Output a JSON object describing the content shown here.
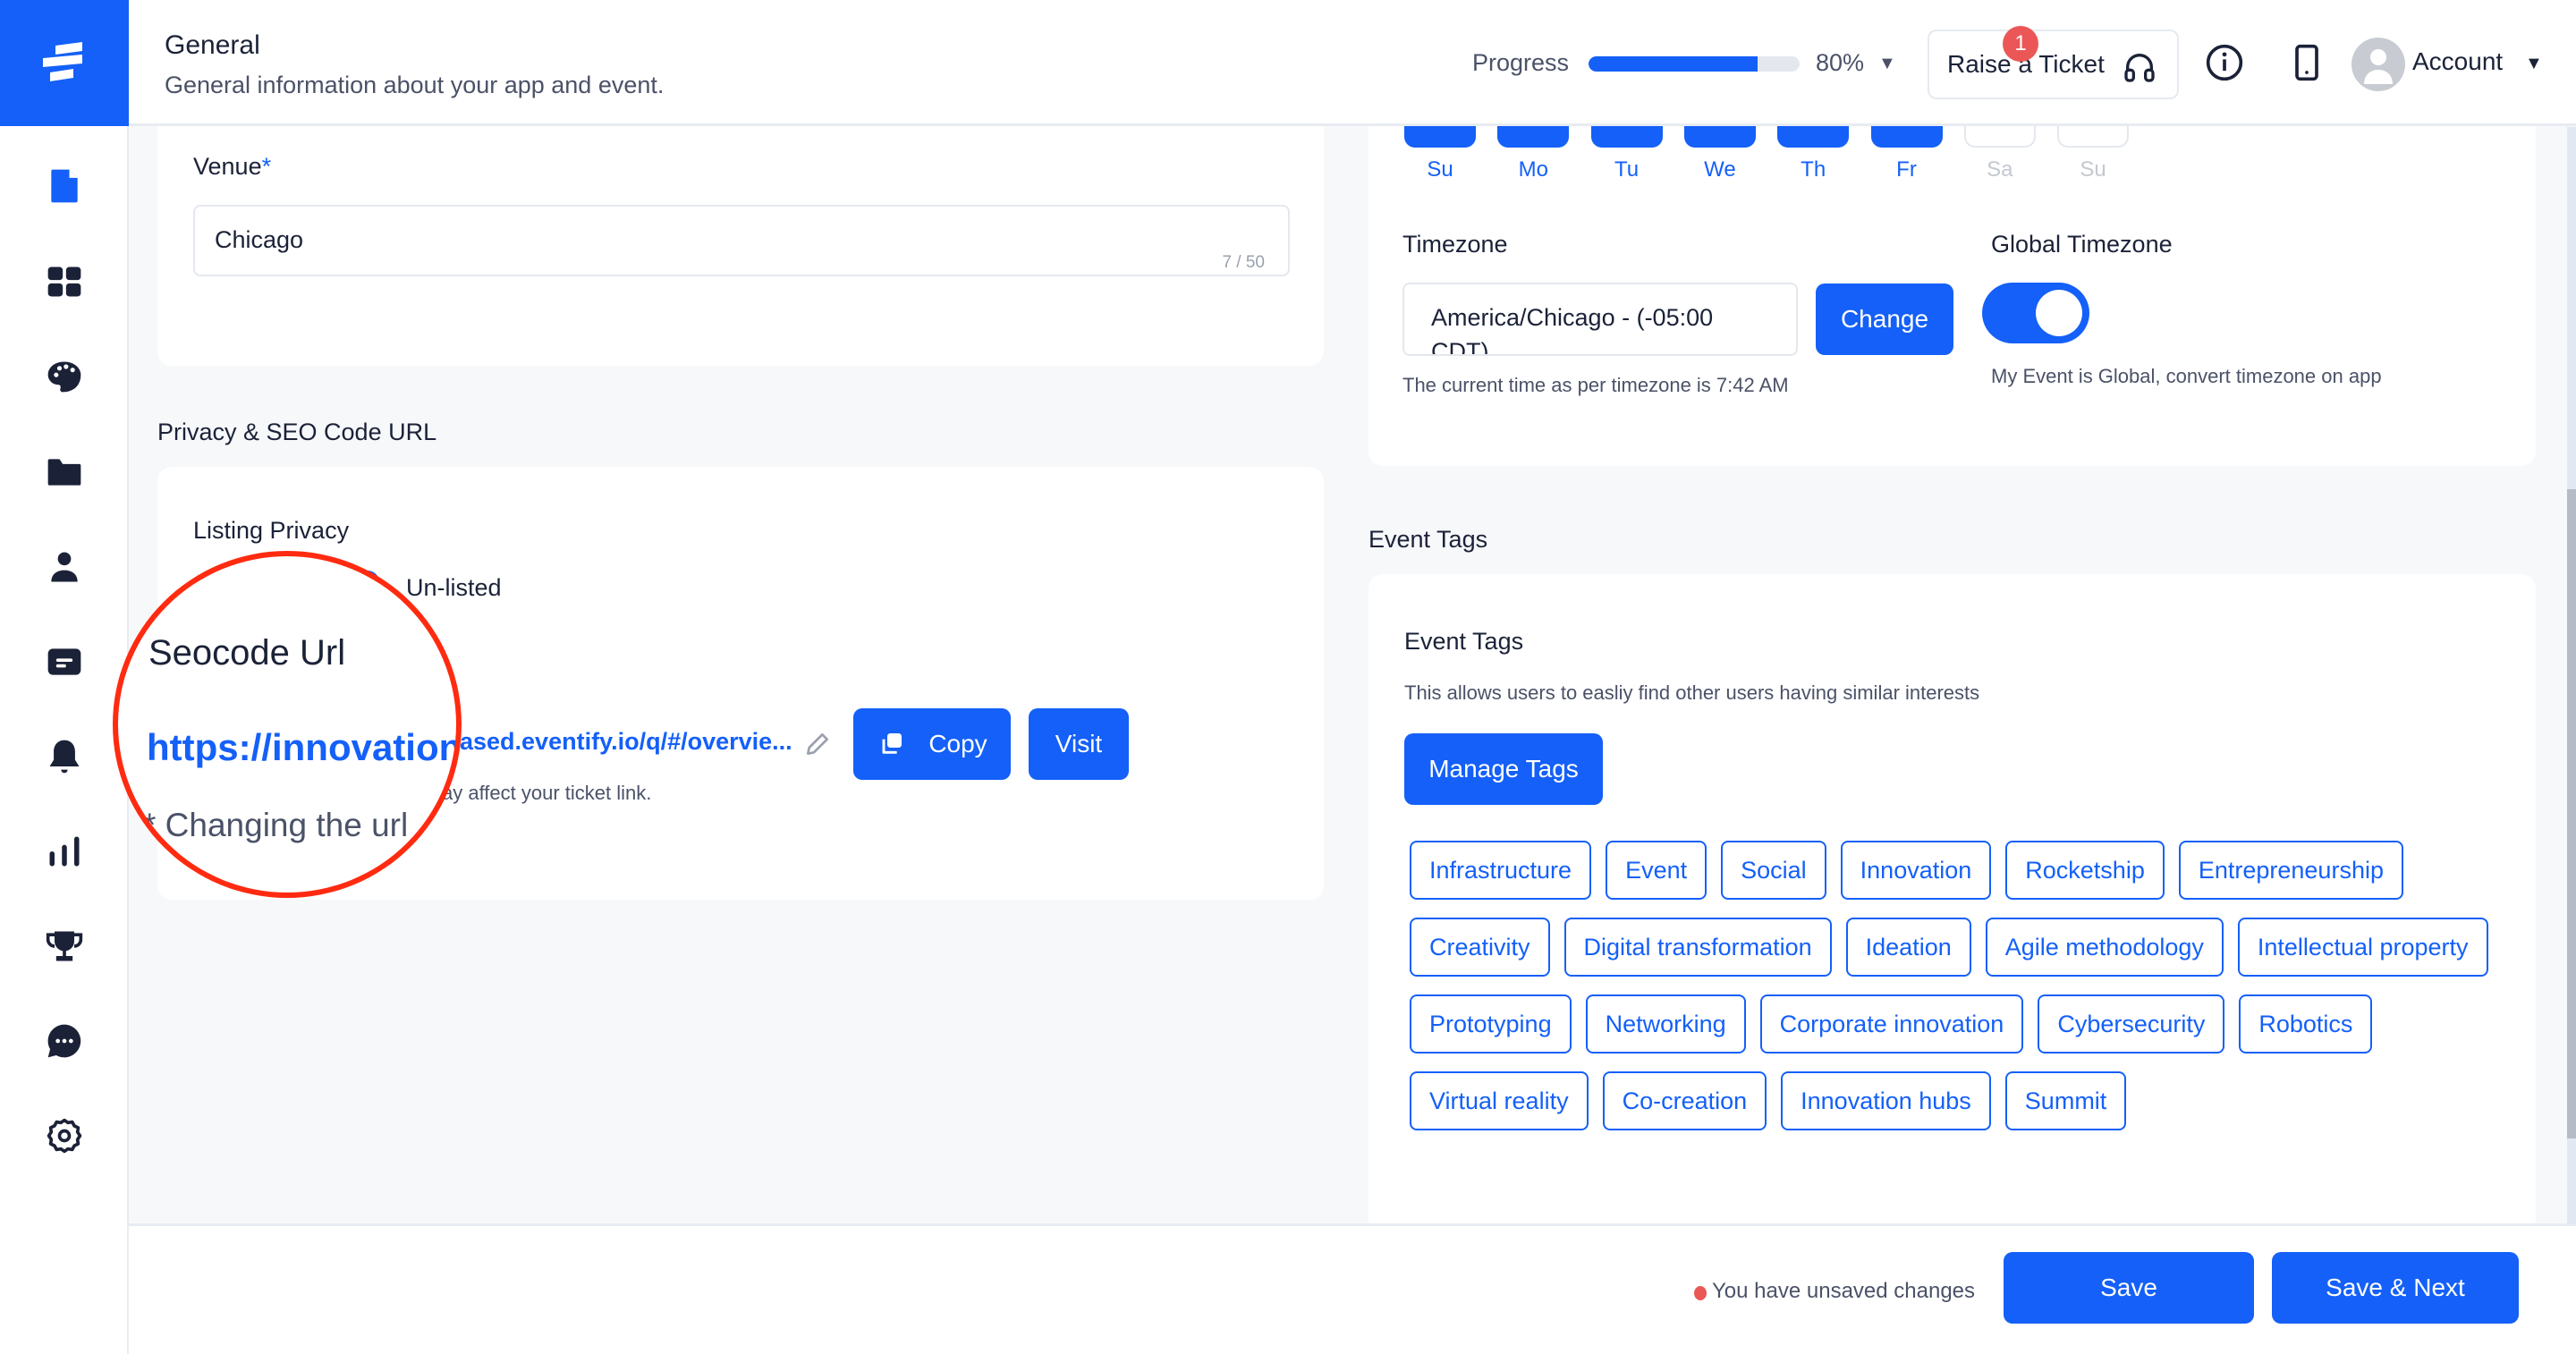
{
  "header": {
    "title": "General",
    "subtitle": "General information about your app and event.",
    "progress_label": "Progress",
    "progress_value": "80%",
    "progress_fraction": 0.8,
    "raise_ticket_label": "Raise a Ticket",
    "ticket_badge_count": "1",
    "account_label": "Account"
  },
  "sidebar": {
    "items": [
      {
        "name": "document",
        "icon": "document-icon",
        "active": true
      },
      {
        "name": "dashboard",
        "icon": "grid-icon"
      },
      {
        "name": "design",
        "icon": "palette-icon"
      },
      {
        "name": "files",
        "icon": "folder-icon"
      },
      {
        "name": "people",
        "icon": "user-icon"
      },
      {
        "name": "sessions",
        "icon": "card-icon"
      },
      {
        "name": "notifications",
        "icon": "bell-icon"
      },
      {
        "name": "analytics",
        "icon": "bar-chart-icon"
      },
      {
        "name": "leaderboard",
        "icon": "trophy-icon"
      },
      {
        "name": "chat",
        "icon": "chat-icon"
      },
      {
        "name": "settings",
        "icon": "gear-icon"
      }
    ]
  },
  "venue": {
    "label": "Venue",
    "required_mark": "*",
    "value": "Chicago",
    "counter": "7 / 50"
  },
  "privacy": {
    "section_title": "Privacy & SEO Code URL",
    "listing_privacy_label": "Listing Privacy",
    "unlisted_option": "Un-listed",
    "seocode_label": "Seocode Url",
    "url_visible": "ased.eventify.io/q/#/overvie...",
    "url_magnified": "https://innovation",
    "url_hint_visible": "ay affect your ticket link.",
    "url_hint_magnified": "* Changing the url",
    "copy_label": "Copy",
    "visit_label": "Visit"
  },
  "schedule": {
    "days": [
      {
        "label": "Su",
        "checked": true
      },
      {
        "label": "Mo",
        "checked": true
      },
      {
        "label": "Tu",
        "checked": true
      },
      {
        "label": "We",
        "checked": true
      },
      {
        "label": "Th",
        "checked": true
      },
      {
        "label": "Fr",
        "checked": true
      },
      {
        "label": "Sa",
        "checked": false
      },
      {
        "label": "Su",
        "checked": false
      }
    ]
  },
  "timezone": {
    "label": "Timezone",
    "value_line1": "America/Chicago - (-05:00",
    "value_line2": "CDT)",
    "change_label": "Change",
    "current_time_text": "The current time as per timezone is 7:42 AM",
    "global_label": "Global Timezone",
    "global_enabled": true,
    "global_hint": "My Event is Global, convert timezone on app"
  },
  "tags": {
    "section_title": "Event Tags",
    "card_title": "Event Tags",
    "description": "This allows users to easliy find other users having similar interests",
    "manage_label": "Manage Tags",
    "items": [
      "Infrastructure",
      "Event",
      "Social",
      "Innovation",
      "Rocketship",
      "Entrepreneurship",
      "Creativity",
      "Digital transformation",
      "Ideation",
      "Agile methodology",
      "Intellectual property",
      "Prototyping",
      "Networking",
      "Corporate innovation",
      "Cybersecurity",
      "Robotics",
      "Virtual reality",
      "Co-creation",
      "Innovation hubs",
      "Summit"
    ]
  },
  "footer": {
    "unsaved_text": "You have unsaved changes",
    "save_label": "Save",
    "save_next_label": "Save & Next"
  },
  "colors": {
    "accent": "#1460f8",
    "danger": "#eb5757",
    "annotation": "#ff2b10"
  }
}
